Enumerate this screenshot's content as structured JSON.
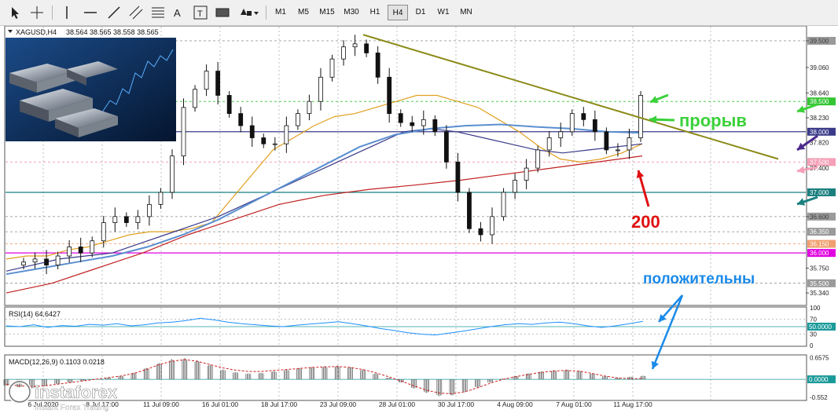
{
  "toolbar": {
    "timeframes": [
      "M1",
      "M5",
      "M15",
      "M30",
      "H1",
      "H4",
      "D1",
      "W1",
      "MN"
    ],
    "active_timeframe": "H4",
    "tools": [
      "cursor-icon",
      "crosshair-icon",
      "vertical-line-icon",
      "horizontal-line-icon",
      "trendline-icon",
      "equidistant-channel-icon",
      "fibonacci-icon",
      "text-icon",
      "text-label-icon",
      "rectangle-icon",
      "shapes-dropdown-icon"
    ]
  },
  "chart_data": [
    {
      "type": "candlestick",
      "symbol_label": "XAGUSD,H4",
      "ohlc_label": "38.564 38.565 38.558 38.565",
      "ylim": [
        35.16,
        39.72
      ],
      "x_tick_labels": [
        "6 Jul 2020",
        "8 Jul 17:00",
        "11 Jul 09:00",
        "16 Jul 01:00",
        "18 Jul 17:00",
        "23 Jul 09:00",
        "28 Jul 01:00",
        "30 Jul 17:00",
        "4 Aug 09:00",
        "7 Aug 01:00",
        "11 Aug 17:00"
      ],
      "y_tick_labels": [
        39.5,
        39.06,
        38.64,
        38.23,
        37.82,
        37.4,
        36.6,
        35.75,
        35.34
      ],
      "horizontal_levels": [
        {
          "value": 39.5,
          "label": "39.500",
          "color": "#9a9a9a",
          "style": "dash"
        },
        {
          "value": 38.5,
          "label": "38.500",
          "color": "#33c533",
          "style": "dash"
        },
        {
          "value": 38.0,
          "label": "38.000",
          "color": "#3a3a8a",
          "style": "solid"
        },
        {
          "value": 37.5,
          "label": "37.500",
          "color": "#f5a0b8",
          "style": "dash"
        },
        {
          "value": 37.0,
          "label": "37.000",
          "color": "#1b7f7f",
          "style": "solid"
        },
        {
          "value": 36.6,
          "label": "36.600",
          "color": "#9a9a9a",
          "style": "dash"
        },
        {
          "value": 36.35,
          "label": "36.350",
          "color": "#9a9a9a",
          "style": "dash"
        },
        {
          "value": 36.15,
          "label": "36.150",
          "color": "#f0a070",
          "style": "dash"
        },
        {
          "value": 36.0,
          "label": "36.000",
          "color": "#e000e0",
          "style": "solid"
        },
        {
          "value": 35.5,
          "label": "35.500",
          "color": "#9a9a9a",
          "style": "dash"
        }
      ],
      "series": [
        {
          "values": [
            35.85,
            35.9,
            35.8,
            35.95,
            36.1,
            36.0,
            36.2,
            36.5,
            36.6,
            36.5,
            36.6,
            36.8,
            37.0,
            37.6,
            38.4,
            38.7,
            39.0,
            38.6,
            38.3,
            38.1,
            37.9,
            37.8,
            37.8,
            38.1,
            38.3,
            38.5,
            38.9,
            39.2,
            39.4,
            39.45,
            39.3,
            38.9,
            38.3,
            38.15,
            38.1,
            38.2,
            38.0,
            37.5,
            37.0,
            36.4,
            36.3,
            36.6,
            37.0,
            37.2,
            37.4,
            37.7,
            37.9,
            38.0,
            38.3,
            38.2,
            38.0,
            37.7,
            37.7,
            37.9,
            38.6
          ]
        },
        {
          "values": [
            35.9,
            35.95,
            35.95,
            36.05,
            36.1,
            36.2,
            36.3,
            36.35,
            36.35,
            36.4,
            36.5,
            36.9,
            37.3,
            37.7,
            37.9,
            38.1,
            38.25,
            38.3,
            38.4,
            38.5,
            38.6,
            38.6,
            38.5,
            38.4,
            38.2,
            38.0,
            37.75,
            37.55,
            37.5,
            37.55,
            37.65,
            37.8
          ]
        },
        {
          "values": [
            35.7,
            35.8,
            35.9,
            35.95,
            36.0,
            36.15,
            36.3,
            36.45,
            36.6,
            36.8,
            37.0,
            37.2,
            37.4,
            37.6,
            37.8,
            38.0,
            38.05,
            38.0,
            37.9,
            37.8,
            37.7,
            37.65,
            37.7,
            37.75,
            37.8
          ]
        },
        {
          "values": [
            35.65,
            35.75,
            35.85,
            35.95,
            36.1,
            36.3,
            36.55,
            36.85,
            37.15,
            37.45,
            37.75,
            37.95,
            38.05,
            38.1,
            38.12,
            38.08,
            38.05,
            38.0,
            37.98
          ]
        },
        {
          "values": [
            35.34,
            35.5,
            35.75,
            36.0,
            36.3,
            36.55,
            36.8,
            36.95,
            37.05,
            37.12,
            37.2,
            37.3,
            37.4,
            37.5,
            37.6
          ]
        }
      ],
      "trendline": {
        "from": 39.6,
        "to": 37.55
      },
      "annotations": [
        "прорыв",
        "200",
        "положительны"
      ]
    },
    {
      "type": "line",
      "label": "RSI(14) 64.6427",
      "ylim": [
        0,
        100
      ],
      "levels": [
        70,
        50,
        30
      ],
      "y_tick_labels": [
        "100",
        "70",
        "50.0000",
        "30",
        "0"
      ],
      "series": [
        {
          "values": [
            52,
            50,
            55,
            48,
            53,
            51,
            56,
            54,
            58,
            52,
            55,
            60,
            62,
            66,
            72,
            68,
            62,
            58,
            55,
            52,
            50,
            54,
            57,
            60,
            63,
            58,
            52,
            45,
            40,
            34,
            30,
            28,
            33,
            38,
            44,
            50,
            55,
            58,
            56,
            60,
            62,
            58,
            52,
            48,
            52,
            58,
            64
          ]
        }
      ]
    },
    {
      "type": "bar",
      "label": "MACD(12,26,9) 0.1103 0.0218",
      "ylim": [
        -0.62,
        0.72
      ],
      "y_tick_labels": [
        "0.6575",
        "0.0000",
        "-0.552"
      ],
      "series": [
        {
          "values": [
            -0.2,
            -0.25,
            -0.28,
            -0.22,
            -0.15,
            -0.1,
            -0.05,
            0.0,
            0.05,
            0.1,
            0.2,
            0.35,
            0.5,
            0.62,
            0.65,
            0.58,
            0.45,
            0.3,
            0.22,
            0.18,
            0.2,
            0.25,
            0.3,
            0.35,
            0.38,
            0.4,
            0.42,
            0.38,
            0.3,
            0.18,
            0.05,
            -0.1,
            -0.28,
            -0.42,
            -0.52,
            -0.5,
            -0.4,
            -0.25,
            -0.1,
            0.02,
            0.1,
            0.18,
            0.24,
            0.28,
            0.3,
            0.26,
            0.18,
            0.1,
            0.05,
            0.08,
            0.11
          ]
        },
        {
          "values": [
            -0.15,
            -0.2,
            -0.22,
            -0.2,
            -0.15,
            -0.1,
            -0.05,
            0.0,
            0.05,
            0.1,
            0.18,
            0.3,
            0.45,
            0.55,
            0.6,
            0.55,
            0.45,
            0.35,
            0.28,
            0.24,
            0.24,
            0.27,
            0.3,
            0.33,
            0.36,
            0.38,
            0.39,
            0.36,
            0.3,
            0.2,
            0.08,
            -0.05,
            -0.2,
            -0.33,
            -0.42,
            -0.44,
            -0.38,
            -0.26,
            -0.12,
            0.0,
            0.08,
            0.15,
            0.21,
            0.25,
            0.27,
            0.25,
            0.18,
            0.1,
            0.04,
            0.02,
            0.02
          ]
        }
      ]
    }
  ],
  "watermark": {
    "brand": "instaforex",
    "tagline": "Instant Forex Trading"
  }
}
